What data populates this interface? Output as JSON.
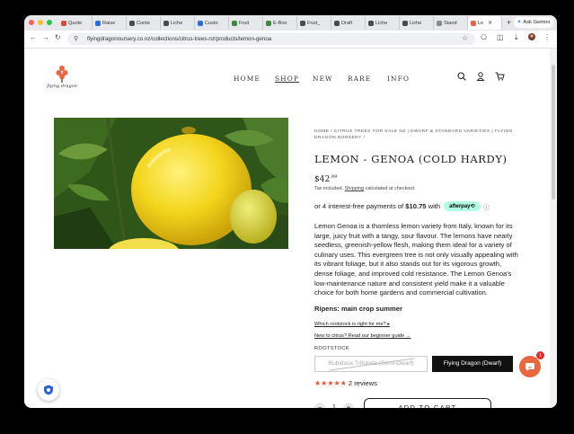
{
  "browser": {
    "tabs": [
      {
        "label": "Quote",
        "color": "#d94c3a"
      },
      {
        "label": "Raise",
        "color": "#2a6fd6"
      },
      {
        "label": "Conte",
        "color": "#4a4a4a"
      },
      {
        "label": "Liche",
        "color": "#4a4a4a"
      },
      {
        "label": "Custo",
        "color": "#2a6fd6"
      },
      {
        "label": "Fruit",
        "color": "#3a8a3a"
      },
      {
        "label": "E-Boo",
        "color": "#3a8a3a"
      },
      {
        "label": "Fruit_",
        "color": "#4a4a4a"
      },
      {
        "label": "Draft",
        "color": "#4a4a4a"
      },
      {
        "label": "Liche",
        "color": "#4a4a4a"
      },
      {
        "label": "Liche",
        "color": "#4a4a4a"
      },
      {
        "label": "Stand",
        "color": "#888888"
      },
      {
        "label": "Le",
        "color": "#e9663f"
      }
    ],
    "active_tab_close": "✕",
    "new_tab": "+",
    "gemini_label": "Ask Gemini",
    "url": "flyingdragonnursery.co.nz/collections/citrus-trees-nz/products/lemon-genoa"
  },
  "site": {
    "logo_text": "flying dragon",
    "nav": [
      "HOME",
      "SHOP",
      "NEW",
      "RARE",
      "INFO"
    ],
    "icons": [
      "search-icon",
      "account-icon",
      "cart-icon"
    ]
  },
  "product": {
    "breadcrumb": "HOME / CITRUS TREES FOR SALE NZ | DWARF & STANDARD VARIETIES | FLYING DRAGON NURSERY /",
    "title": "LEMON - GENOA (COLD HARDY)",
    "price_main": "$42",
    "price_cents": ".99",
    "tax_prefix": "Tax included. ",
    "tax_link": "Shipping",
    "tax_suffix": " calculated at checkout.",
    "afterpay_prefix": "or 4 interest-free payments of ",
    "afterpay_amount": "$10.75",
    "afterpay_suffix": " with",
    "afterpay_badge": "afterpay⟲",
    "afterpay_info": "ⓘ",
    "description": "Lemon Genoa is a thornless lemon variety from Italy, known for its large, juicy fruit with a tangy, sour flavour. The lemons have nearly seedless, greenish-yellow flesh, making them ideal for a variety of culinary uses. This evergreen tree is not only visually appealing with its vibrant foliage, but it also stands out for its vigorous growth, dense foliage, and improved cold resistance. The Lemon Genoa's low-maintenance nature and consistent yield make it a valuable choice for both home gardens and commercial cultivation.",
    "ripens": "Ripens: main crop summer",
    "link_rootstock": "Which rootstock is right for me? ▸",
    "link_beginner": "New to citrus? Read our beginner guide →",
    "rootstock_label": "ROOTSTOCK",
    "rootstock_options": [
      "Rubidoux Trifoliata (Semi-Dwarf)",
      "Flying Dragon (Dwarf)"
    ],
    "rootstock_selected": "Flying Dragon (Dwarf)",
    "rating_stars": "★★★★★",
    "reviews": "2 reviews",
    "qty_minus": "−",
    "qty": "1",
    "qty_plus": "+",
    "add_to_cart": "ADD TO CART"
  },
  "chat": {
    "badge": "1"
  }
}
